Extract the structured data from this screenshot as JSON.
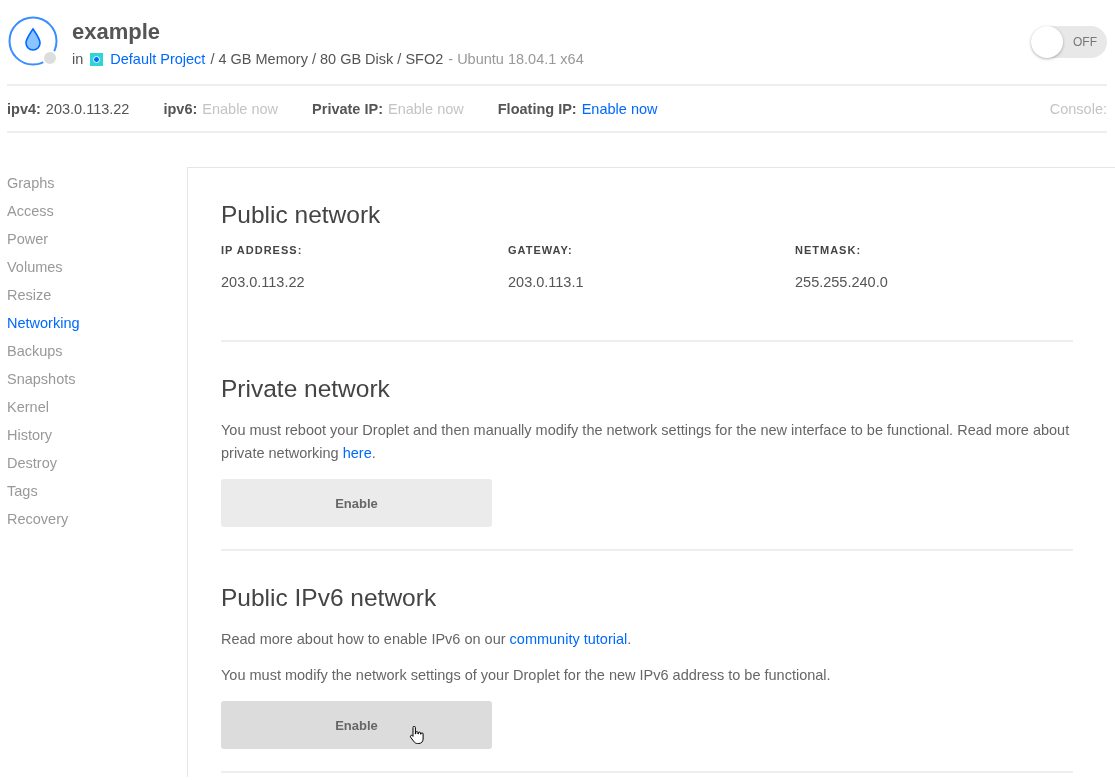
{
  "droplet": {
    "name": "example",
    "status_on": false,
    "prefix": "in",
    "project": "Default Project",
    "specs": "/ 4 GB Memory / 80 GB Disk / SFO2",
    "image": "- Ubuntu 18.04.1 x64"
  },
  "power_toggle": {
    "label": "OFF",
    "on": false
  },
  "ip_bar": {
    "items": [
      {
        "label": "ipv4:",
        "value": "203.0.113.22",
        "kind": "plain"
      },
      {
        "label": "ipv6:",
        "value": "Enable now",
        "kind": "disabled"
      },
      {
        "label": "Private IP:",
        "value": "Enable now",
        "kind": "disabled"
      },
      {
        "label": "Floating IP:",
        "value": "Enable now",
        "kind": "link"
      }
    ],
    "console": "Console:"
  },
  "sidebar": {
    "items": [
      {
        "label": "Graphs",
        "selected": false
      },
      {
        "label": "Access",
        "selected": false
      },
      {
        "label": "Power",
        "selected": false
      },
      {
        "label": "Volumes",
        "selected": false
      },
      {
        "label": "Resize",
        "selected": false
      },
      {
        "label": "Networking",
        "selected": true
      },
      {
        "label": "Backups",
        "selected": false
      },
      {
        "label": "Snapshots",
        "selected": false
      },
      {
        "label": "Kernel",
        "selected": false
      },
      {
        "label": "History",
        "selected": false
      },
      {
        "label": "Destroy",
        "selected": false
      },
      {
        "label": "Tags",
        "selected": false
      },
      {
        "label": "Recovery",
        "selected": false
      }
    ]
  },
  "sections": [
    {
      "title": "Public network",
      "fields": [
        {
          "label": "IP ADDRESS:",
          "value": "203.0.113.22"
        },
        {
          "label": "GATEWAY:",
          "value": "203.0.113.1"
        },
        {
          "label": "NETMASK:",
          "value": "255.255.240.0"
        }
      ]
    },
    {
      "title": "Private network",
      "paragraphs": [
        {
          "text": "You must reboot your Droplet and then manually modify the network settings for the new interface to be functional. Read more about private networking ",
          "link": "here",
          "after": "."
        }
      ],
      "button": {
        "label": "Enable",
        "hovered": false
      }
    },
    {
      "title": "Public IPv6 network",
      "paragraphs": [
        {
          "text": "Read more about how to enable IPv6 on our ",
          "link": "community tutorial",
          "after": "."
        },
        {
          "text": "You must modify the network settings of your Droplet for the new IPv6 address to be functional."
        }
      ],
      "button": {
        "label": "Enable",
        "hovered": true
      }
    }
  ]
}
